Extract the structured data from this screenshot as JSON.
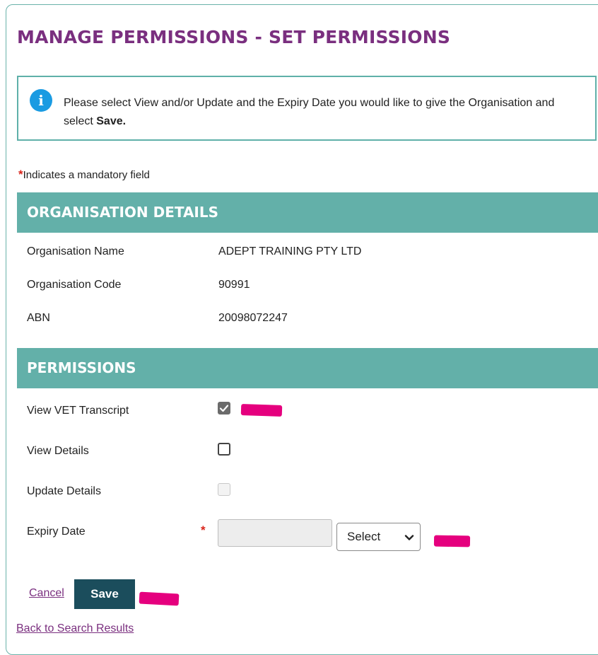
{
  "page": {
    "title": "MANAGE PERMISSIONS - SET PERMISSIONS"
  },
  "info": {
    "icon": "info-icon",
    "text_before": "Please select View and/or Update and the Expiry Date you would like to give the Organisation and select ",
    "text_bold": "Save."
  },
  "mandatory_note": {
    "symbol": "*",
    "text": "Indicates a mandatory field"
  },
  "organisation": {
    "header": "ORGANISATION DETAILS",
    "rows": [
      {
        "label": "Organisation Name",
        "value": "ADEPT TRAINING PTY LTD"
      },
      {
        "label": "Organisation Code",
        "value": "90991"
      },
      {
        "label": "ABN",
        "value": "20098072247"
      }
    ]
  },
  "permissions": {
    "header": "PERMISSIONS",
    "view_vet_transcript": {
      "label": "View VET Transcript",
      "checked": true
    },
    "view_details": {
      "label": "View Details",
      "checked": false
    },
    "update_details": {
      "label": "Update Details",
      "checked": false,
      "disabled": true
    },
    "expiry_date": {
      "label": "Expiry Date",
      "required_symbol": "*",
      "value": "",
      "select_value": "Select"
    }
  },
  "actions": {
    "cancel_label": "Cancel",
    "save_label": "Save",
    "back_label": "Back to Search Results"
  },
  "colors": {
    "title": "#7a2f7f",
    "section_header": "#63b0a9",
    "info_border": "#5fb0a9",
    "info_icon": "#1a9be2",
    "save_button": "#1b4d5c",
    "required": "#d9241b",
    "annotation_highlight": "#e5007e"
  }
}
